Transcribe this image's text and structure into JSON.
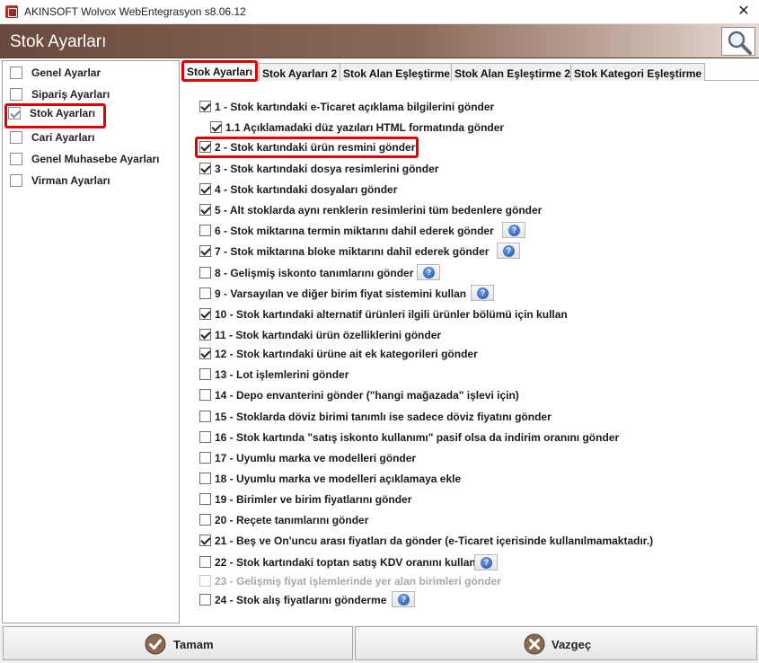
{
  "window": {
    "title": "AKINSOFT Wolvox WebEntegrasyon s8.06.12",
    "close_glyph": "✕"
  },
  "header": {
    "title": "Stok Ayarları",
    "search_icon": "magnifier-icon"
  },
  "sidebar": {
    "items": [
      {
        "label": "Genel Ayarlar",
        "checked": false
      },
      {
        "label": "Sipariş Ayarları",
        "checked": false
      },
      {
        "label": "Stok Ayarları",
        "checked": true,
        "active": true
      },
      {
        "label": "Cari Ayarları",
        "checked": false
      },
      {
        "label": "Genel Muhasebe Ayarları",
        "checked": false
      },
      {
        "label": "Virman Ayarları",
        "checked": false
      }
    ]
  },
  "tabs": [
    {
      "label": "Stok Ayarları",
      "active": true
    },
    {
      "label": "Stok Ayarları 2"
    },
    {
      "label": "Stok Alan Eşleştirme"
    },
    {
      "label": "Stok Alan Eşleştirme 2"
    },
    {
      "label": "Stok Kategori Eşleştirme"
    }
  ],
  "options": [
    {
      "label": "1 - Stok kartındaki e-Ticaret açıklama bilgilerini gönder",
      "checked": true
    },
    {
      "label": "1.1 Açıklamadaki düz yazıları HTML formatında gönder",
      "checked": true
    },
    {
      "label": "2 - Stok kartındaki ürün resmini gönder",
      "checked": true
    },
    {
      "label": "3 - Stok kartındaki dosya resimlerini gönder",
      "checked": true
    },
    {
      "label": "4 - Stok kartındaki dosyaları gönder",
      "checked": true
    },
    {
      "label": "5 - Alt stoklarda aynı renklerin resimlerini tüm bedenlere gönder",
      "checked": true
    },
    {
      "label": "6 - Stok miktarına termin miktarını dahil ederek gönder",
      "checked": false,
      "help": true
    },
    {
      "label": "7 - Stok miktarına bloke miktarını dahil ederek gönder",
      "checked": true,
      "help": true
    },
    {
      "label": "8 - Gelişmiş iskonto tanımlarını gönder",
      "checked": false,
      "help": true
    },
    {
      "label": "9 - Varsayılan ve diğer birim fiyat sistemini kullan",
      "checked": false,
      "help": true
    },
    {
      "label": "10 - Stok kartındaki alternatif ürünleri ilgili ürünler bölümü için kullan",
      "checked": true
    },
    {
      "label": "11 - Stok kartındaki ürün özelliklerini gönder",
      "checked": true
    },
    {
      "label": "12 - Stok kartındaki ürüne ait ek kategorileri gönder",
      "checked": true
    },
    {
      "label": "13 - Lot işlemlerini gönder",
      "checked": false
    },
    {
      "label": "14 - Depo envanterini gönder (\"hangi mağazada\" işlevi için)",
      "checked": false
    },
    {
      "label": "15 - Stoklarda döviz birimi tanımlı ise sadece döviz fiyatını gönder",
      "checked": false
    },
    {
      "label": "16 - Stok kartında \"satış iskonto kullanımı\" pasif olsa da indirim oranını gönder",
      "checked": false
    },
    {
      "label": "17 - Uyumlu marka ve modelleri gönder",
      "checked": false
    },
    {
      "label": "18 - Uyumlu marka ve modelleri açıklamaya ekle",
      "checked": false
    },
    {
      "label": "19 - Birimler ve birim fiyatlarını gönder",
      "checked": false
    },
    {
      "label": "20 - Reçete tanımlarını gönder",
      "checked": false
    },
    {
      "label": "21 - Beş ve On'uncu arası fiyatları da gönder (e-Ticaret içerisinde kullanılmamaktadır.)",
      "checked": true
    },
    {
      "label": "22 - Stok kartındaki toptan satış KDV oranını kullan",
      "checked": false,
      "help": true
    },
    {
      "label": "23 - Gelişmiş fiyat işlemlerinde yer alan birimleri gönder",
      "checked": false,
      "disabled": true
    },
    {
      "label": "24 - Stok alış fiyatlarını gönderme",
      "checked": false,
      "help": true
    }
  ],
  "help_glyph": "?",
  "buttons": {
    "ok_label": "Tamam",
    "cancel_label": "Vazgeç"
  }
}
